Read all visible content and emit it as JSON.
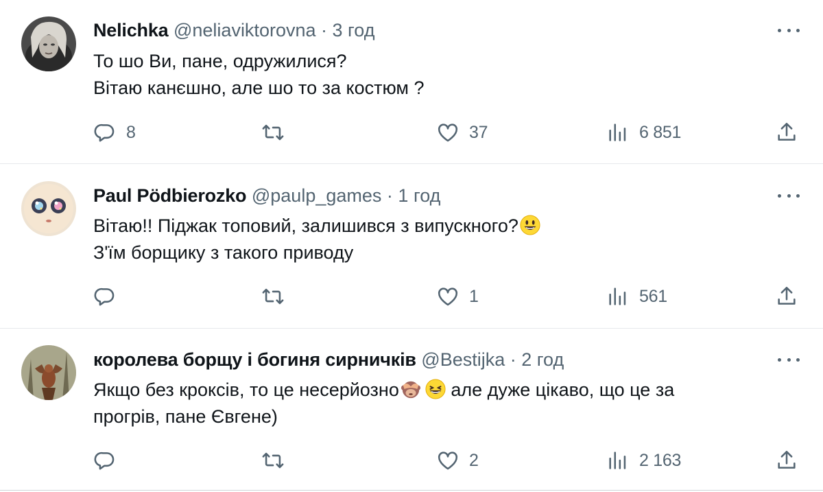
{
  "tweets": [
    {
      "name": "Nelichka",
      "handle": "@neliaviktorovna",
      "sep": "·",
      "time": "3 год",
      "lines": [
        "То шо Ви, пане, одружилися?",
        "Вітаю канєшно, але шо то за костюм ?"
      ],
      "replies": "8",
      "retweets": "",
      "likes": "37",
      "views": "6 851"
    },
    {
      "name": "Paul Pödbierozko",
      "handle": "@paulp_games",
      "sep": "·",
      "time": "1 год",
      "lines": [
        "Вітаю!! Піджак топовий, залишився з випускного?",
        "З'їм борщику з такого приводу"
      ],
      "replies": "",
      "retweets": "",
      "likes": "1",
      "views": "561"
    },
    {
      "name": "королева борщу і богиня сирничків",
      "handle": "@Bestijka",
      "sep": "·",
      "time": "2 год",
      "lines": [
        "Якщо без кроксів, то це несерйозно",
        " але дуже цікаво, що це за",
        "прогрів, пане Євгене)"
      ],
      "replies": "",
      "retweets": "",
      "likes": "2",
      "views": "2 163"
    }
  ],
  "colors": {
    "text": "#0f1419",
    "secondary": "#536471",
    "divider": "#e6e9eb"
  },
  "icons": [
    "reply-icon",
    "retweet-icon",
    "like-icon",
    "views-icon",
    "share-icon",
    "more-icon"
  ]
}
